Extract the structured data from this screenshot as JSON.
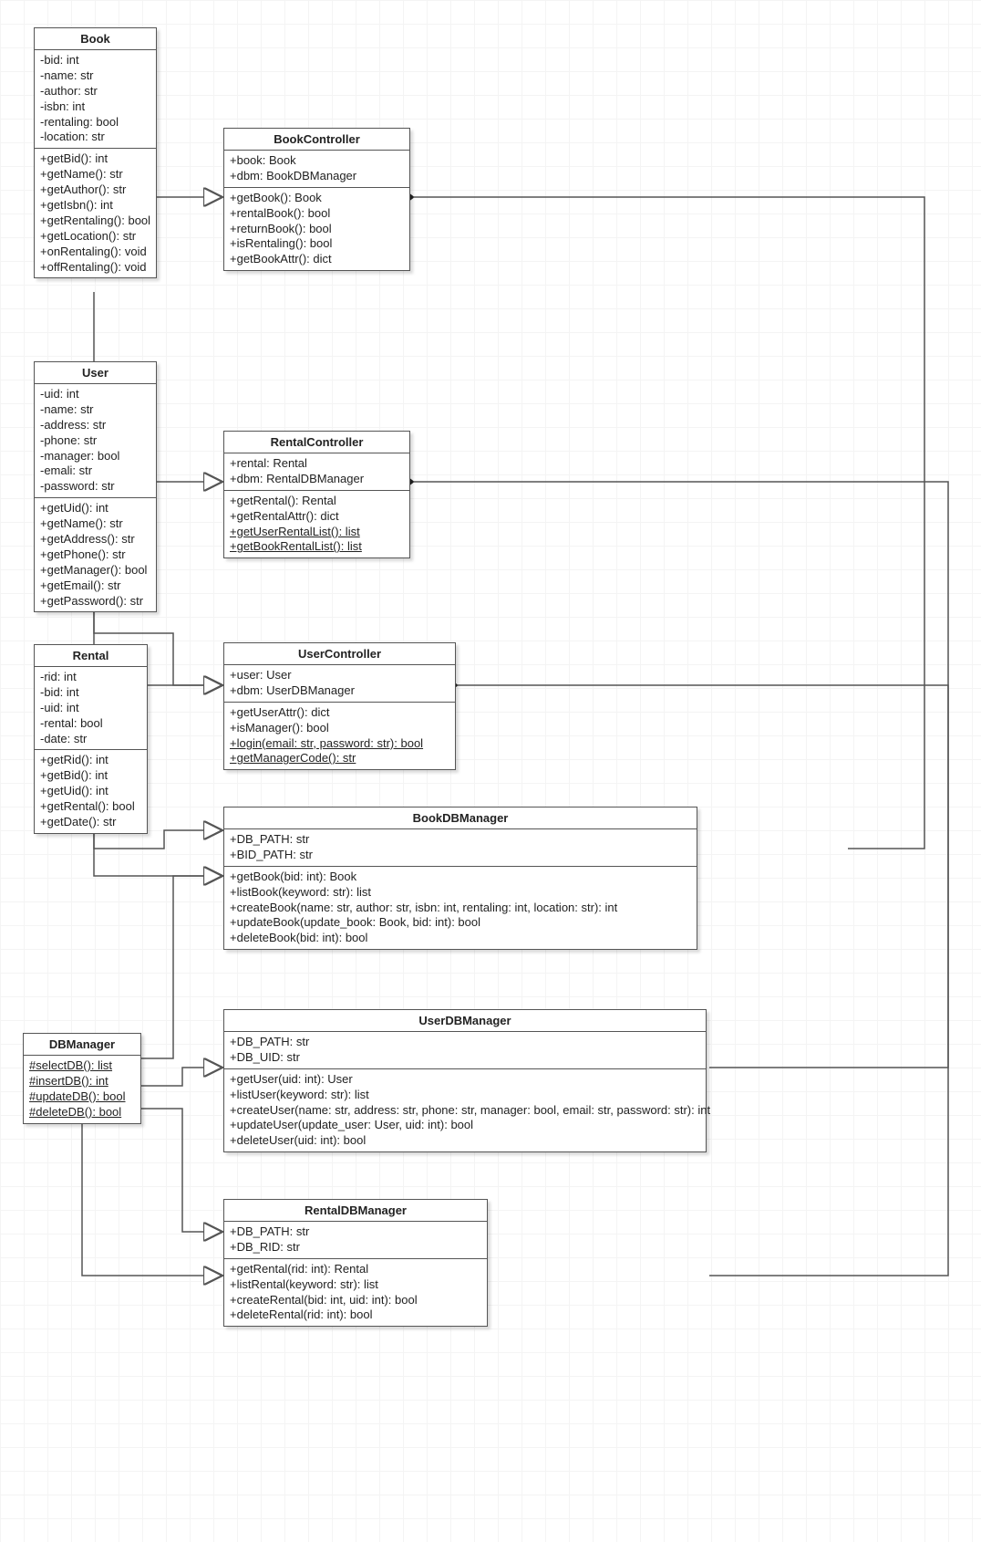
{
  "classes": {
    "book": {
      "title": "Book",
      "attrs": [
        "-bid: int",
        "-name: str",
        "-author: str",
        "-isbn: int",
        "-rentaling: bool",
        "-location: str"
      ],
      "ops": [
        "+getBid(): int",
        "+getName(): str",
        "+getAuthor(): str",
        "+getIsbn(): int",
        "+getRentaling(): bool",
        "+getLocation(): str",
        "+onRentaling(): void",
        "+offRentaling(): void"
      ]
    },
    "bookController": {
      "title": "BookController",
      "attrs": [
        "+book: Book",
        "+dbm: BookDBManager"
      ],
      "ops": [
        "+getBook(): Book",
        "+rentalBook(): bool",
        "+returnBook(): bool",
        "+isRentaling(): bool",
        "+getBookAttr(): dict"
      ]
    },
    "user": {
      "title": "User",
      "attrs": [
        "-uid: int",
        "-name: str",
        "-address: str",
        "-phone: str",
        "-manager: bool",
        "-emali: str",
        "-password: str"
      ],
      "ops": [
        "+getUid(): int",
        "+getName(): str",
        "+getAddress(): str",
        "+getPhone(): str",
        "+getManager(): bool",
        "+getEmail(): str",
        "+getPassword(): str"
      ]
    },
    "rentalController": {
      "title": "RentalController",
      "attrs": [
        "+rental: Rental",
        "+dbm: RentalDBManager"
      ],
      "ops": [
        "+getRental(): Rental",
        "+getRentalAttr(): dict"
      ],
      "ops_static": [
        "+getUserRentalList(): list",
        "+getBookRentalList(): list"
      ]
    },
    "rental": {
      "title": "Rental",
      "attrs": [
        "-rid: int",
        "-bid: int",
        "-uid: int",
        "-rental: bool",
        "-date: str"
      ],
      "ops": [
        "+getRid(): int",
        "+getBid(): int",
        "+getUid(): int",
        "+getRental(): bool",
        "+getDate(): str"
      ]
    },
    "userController": {
      "title": "UserController",
      "attrs": [
        "+user: User",
        "+dbm: UserDBManager"
      ],
      "ops": [
        "+getUserAttr(): dict",
        "+isManager(): bool"
      ],
      "ops_static": [
        "+login(email: str, password: str): bool",
        "+getManagerCode(): str"
      ]
    },
    "bookDBManager": {
      "title": "BookDBManager",
      "attrs": [
        "+DB_PATH: str",
        "+BID_PATH: str"
      ],
      "ops": [
        "+getBook(bid: int): Book",
        "+listBook(keyword: str): list",
        "+createBook(name: str, author: str, isbn: int, rentaling: int, location: str): int",
        "+updateBook(update_book: Book, bid: int): bool",
        "+deleteBook(bid: int): bool"
      ]
    },
    "userDBManager": {
      "title": "UserDBManager",
      "attrs": [
        "+DB_PATH: str",
        "+DB_UID: str"
      ],
      "ops": [
        "+getUser(uid: int): User",
        "+listUser(keyword: str): list",
        "+createUser(name: str, address: str, phone: str, manager: bool, email: str, password: str): int",
        "+updateUser(update_user: User, uid: int): bool",
        "+deleteUser(uid: int): bool"
      ]
    },
    "dbManager": {
      "title": "DBManager",
      "ops_static": [
        "#selectDB(): list",
        "#insertDB(): int",
        "#updateDB(): bool",
        "#deleteDB(): bool"
      ]
    },
    "rentalDBManager": {
      "title": "RentalDBManager",
      "attrs": [
        "+DB_PATH: str",
        "+DB_RID: str"
      ],
      "ops": [
        "+getRental(rid: int): Rental",
        "+listRental(keyword: str): list",
        "+createRental(bid: int, uid: int): bool",
        "+deleteRental(rid: int): bool"
      ]
    }
  }
}
